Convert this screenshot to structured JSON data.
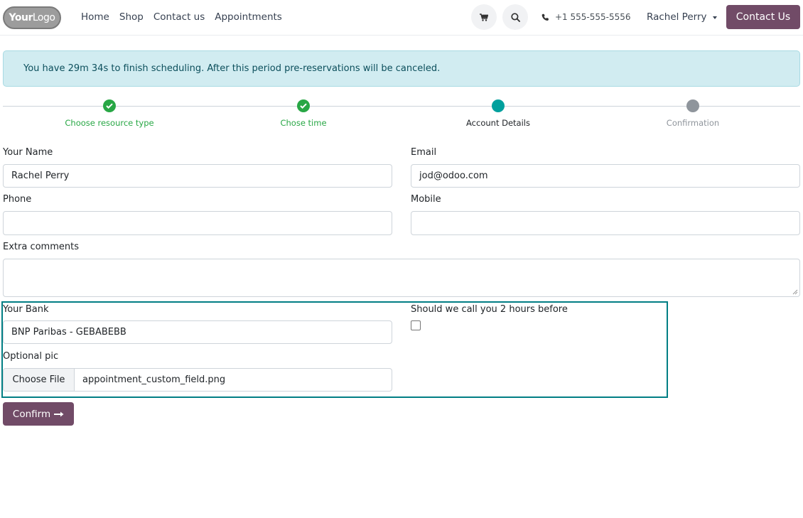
{
  "header": {
    "logo_bold": "Your",
    "logo_light": "Logo",
    "nav": [
      "Home",
      "Shop",
      "Contact us",
      "Appointments"
    ],
    "phone": "+1 555-555-5556",
    "user": "Rachel Perry",
    "contact_button": "Contact Us"
  },
  "alert": {
    "text": "You have 29m 34s to finish scheduling. After this period pre-reservations will be canceled."
  },
  "steps": [
    {
      "label": "Choose resource type",
      "state": "done"
    },
    {
      "label": "Chose time",
      "state": "done"
    },
    {
      "label": "Account Details",
      "state": "current"
    },
    {
      "label": "Confirmation",
      "state": "todo"
    }
  ],
  "form": {
    "name_label": "Your Name",
    "name_value": "Rachel Perry",
    "email_label": "Email",
    "email_value": "jod@odoo.com",
    "phone_label": "Phone",
    "phone_value": "",
    "mobile_label": "Mobile",
    "mobile_value": "",
    "comments_label": "Extra comments",
    "bank_label": "Your Bank",
    "bank_value": "BNP Paribas - GEBABEBB",
    "call_label": "Should we call you 2 hours before",
    "pic_label": "Optional pic",
    "choose_file": "Choose File",
    "file_name": "appointment_custom_field.png",
    "confirm": "Confirm"
  },
  "colors": {
    "brand": "#714b67",
    "success": "#28a745",
    "current": "#00a09d",
    "todo": "#8f959c",
    "highlight": "#017e84",
    "alert_bg": "#d1ecf1"
  }
}
